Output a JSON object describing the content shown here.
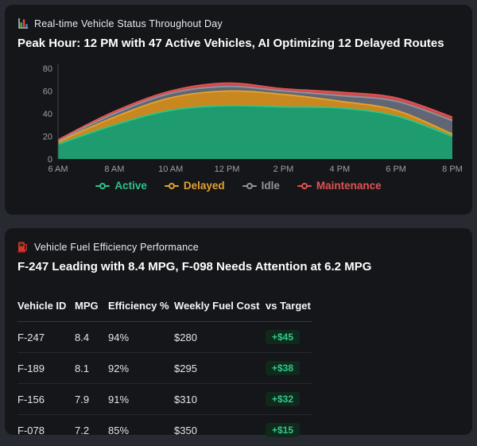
{
  "status_panel": {
    "title": "Real-time Vehicle Status Throughout Day",
    "icon": "bar-chart-icon",
    "insight": "Peak Hour: 12 PM with 47 Active Vehicles, AI Optimizing 12 Delayed Routes"
  },
  "chart_data": {
    "type": "area",
    "stacked": true,
    "title": "Real-time Vehicle Status Throughout Day",
    "x": [
      "6 AM",
      "8 AM",
      "10 AM",
      "12 PM",
      "2 PM",
      "4 PM",
      "6 PM",
      "8 PM"
    ],
    "series": [
      {
        "name": "Active",
        "color": "#2dc489",
        "fill": "#1e9c6f",
        "values": [
          13,
          30,
          43,
          47,
          46,
          45,
          38,
          20
        ]
      },
      {
        "name": "Delayed",
        "color": "#e3a231",
        "fill": "#c9881f",
        "values": [
          2,
          7,
          11,
          13,
          11,
          6,
          5,
          2
        ]
      },
      {
        "name": "Idle",
        "color": "#8f959e",
        "fill": "#606673",
        "values": [
          1,
          3,
          4,
          4,
          3,
          5,
          8,
          12
        ]
      },
      {
        "name": "Maintenance",
        "color": "#e25353",
        "fill": "#c74b50",
        "values": [
          1,
          2,
          2,
          3,
          2,
          3,
          3,
          3
        ]
      }
    ],
    "ylim": [
      0,
      80
    ],
    "yticks": [
      0,
      20,
      40,
      60,
      80
    ],
    "grid": false,
    "legend_position": "bottom"
  },
  "fuel_panel": {
    "title": "Vehicle Fuel Efficiency Performance",
    "icon": "fuel-pump-icon",
    "insight": "F-247 Leading with 8.4 MPG, F-098 Needs Attention at 6.2 MPG",
    "table": {
      "headers": [
        "Vehicle ID",
        "MPG",
        "Efficiency %",
        "Weekly Fuel Cost",
        "vs Target"
      ],
      "rows": [
        {
          "vehicle_id": "F-247",
          "mpg": "8.4",
          "efficiency": "94%",
          "weekly_cost": "$280",
          "vs_target": "+$45"
        },
        {
          "vehicle_id": "F-189",
          "mpg": "8.1",
          "efficiency": "92%",
          "weekly_cost": "$295",
          "vs_target": "+$38"
        },
        {
          "vehicle_id": "F-156",
          "mpg": "7.9",
          "efficiency": "91%",
          "weekly_cost": "$310",
          "vs_target": "+$32"
        },
        {
          "vehicle_id": "F-078",
          "mpg": "7.2",
          "efficiency": "85%",
          "weekly_cost": "$350",
          "vs_target": "+$15"
        }
      ]
    }
  },
  "colors": {
    "page_bg": "#272b31",
    "card_bg": "#141619",
    "axis_label": "#9aa0a8",
    "axis_line": "#3e434b",
    "badge_bg": "#0f2a1d",
    "badge_text": "#32c98a"
  }
}
